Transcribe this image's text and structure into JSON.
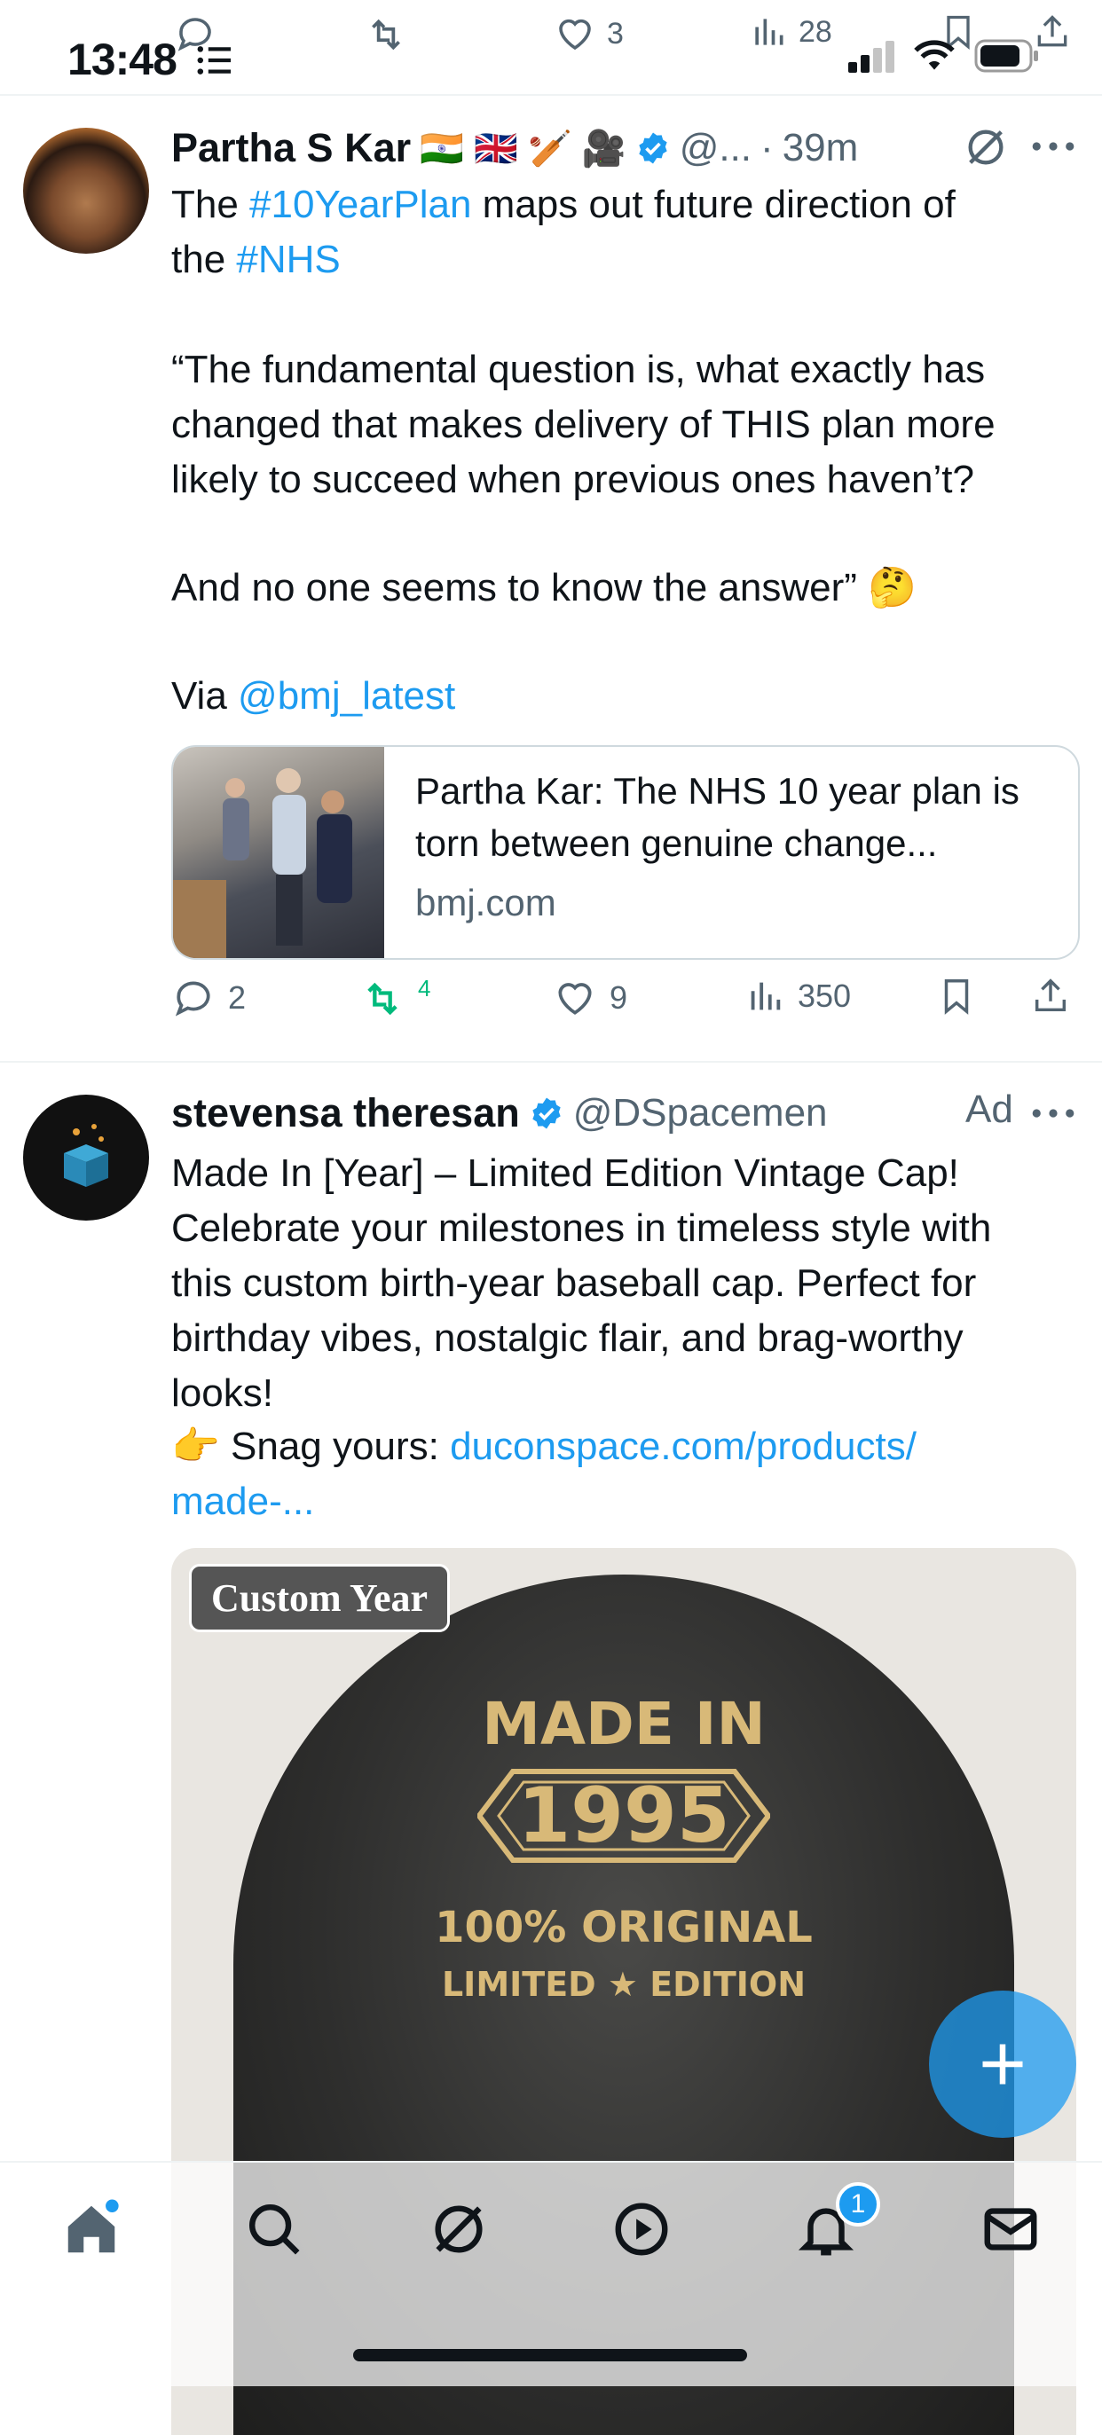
{
  "status": {
    "time": "13:48"
  },
  "previous_tweet_actions": {
    "likes": "3",
    "views": "28"
  },
  "tweet1": {
    "author_name": "Partha S Kar",
    "author_emojis": "🇮🇳 🇬🇧 🏏 🎥",
    "handle": "@...",
    "dot": "·",
    "time": "39m",
    "body_line1_prefix": "The ",
    "hashtag1": "#10YearPlan",
    "body_line1_suffix": " maps out future direction of",
    "body_line2_prefix": "the ",
    "hashtag2": "#NHS",
    "quote": "“The fundamental question is, what exactly has\nchanged that makes delivery of THIS plan more\nlikely to succeed when previous ones haven’t?",
    "answer": "And no one seems to know the answer”",
    "answer_emoji": "🤔",
    "via_label": "Via ",
    "via_mention": "@bmj_latest",
    "card": {
      "title": "Partha Kar: The NHS 10 year plan is torn between genuine change...",
      "domain": "bmj.com"
    },
    "actions": {
      "replies": "2",
      "retweets": "4",
      "likes": "9",
      "views": "350"
    }
  },
  "tweet2": {
    "author_name": "stevensa theresan",
    "handle": "@DSpacemen",
    "ad_label": "Ad",
    "body": "Made In [Year] – Limited Edition Vintage Cap!\nCelebrate your milestones in timeless style with\nthis custom birth-year baseball cap. Perfect for\nbirthday vibes, nostalgic flair, and brag-worthy\nlooks!",
    "cta_emoji": "👉",
    "cta_text": " Snag yours: ",
    "cta_link_line1": "duconspace.com/products/",
    "cta_link_line2": "made-...",
    "image": {
      "badge": "Custom Year",
      "made_in": "MADE IN",
      "year": "1995",
      "original": "100% ORIGINAL",
      "limited": "LIMITED ★ EDITION"
    }
  },
  "bottom_nav": {
    "notification_count": "1"
  },
  "colors": {
    "accent": "#1d9bf0",
    "retweet_green": "#00ba7c",
    "muted": "#536471"
  }
}
